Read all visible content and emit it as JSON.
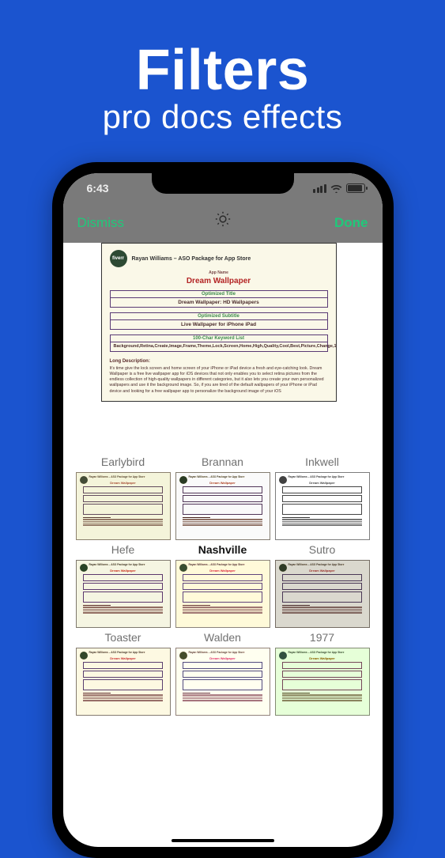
{
  "promo": {
    "title": "Filters",
    "subtitle": "pro docs effects"
  },
  "status": {
    "time": "6:43"
  },
  "nav": {
    "dismiss": "Dismiss",
    "done": "Done",
    "center_icon": "brightness-icon"
  },
  "document": {
    "brand": "fiverr",
    "header": "Rayan Williams – ASO Package for App Store",
    "app_name_label": "App Name",
    "app_name": "Dream Wallpaper",
    "optimized_title_label": "Optimized Title",
    "optimized_title": "Dream Wallpaper: HD Wallpapers",
    "optimized_subtitle_label": "Optimized Subtitle",
    "optimized_subtitle": "Live Wallpaper for iPhone iPad",
    "keyword_list_label": "100-Char Keyword List",
    "keyword_list": "Background,Retina,Create,Image,Frame,Theme,Lock,Screen,Home,High,Quality,Cool,Best,Picture,Change,1",
    "long_desc_heading": "Long Description:",
    "long_desc": "It's time give the lock screen and home screen of your iPhone or iPad device a fresh and eye-catching look. Dream Wallpaper is a free live wallpaper app for iOS devices that not only enables you to select retina pictures from the endless collection of high-quality wallpapers in different categories, but it also lets you create your own personalized wallpapers and use it the background image. So, if you are tired of the default wallpapers of your iPhone or iPad device and looking for a free wallpaper app to personalize the background image of your iOS"
  },
  "filters": [
    {
      "name": "Earlybird",
      "cls": "f-earlybird",
      "selected": false
    },
    {
      "name": "Brannan",
      "cls": "f-brannan",
      "selected": false
    },
    {
      "name": "Inkwell",
      "cls": "f-inkwell",
      "selected": false
    },
    {
      "name": "Hefe",
      "cls": "f-hefe",
      "selected": false
    },
    {
      "name": "Nashville",
      "cls": "f-nashville",
      "selected": true
    },
    {
      "name": "Sutro",
      "cls": "f-sutro",
      "selected": false
    },
    {
      "name": "Toaster",
      "cls": "f-toaster",
      "selected": false
    },
    {
      "name": "Walden",
      "cls": "f-walden",
      "selected": false
    },
    {
      "name": "1977",
      "cls": "f-1977",
      "selected": false
    }
  ]
}
